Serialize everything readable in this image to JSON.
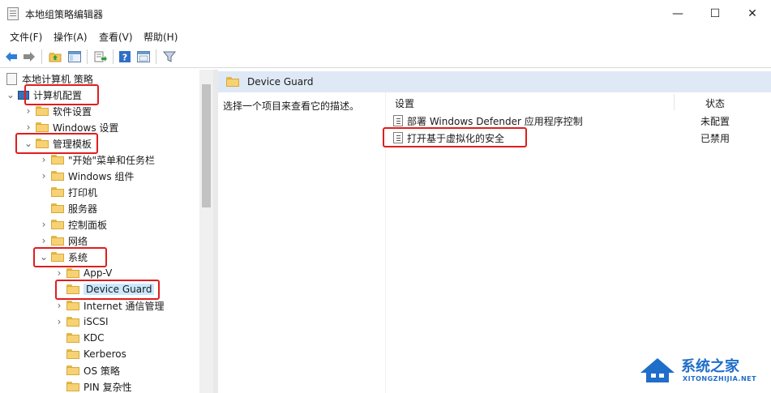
{
  "window": {
    "title": "本地组策略编辑器",
    "controls": {
      "minimize": "—",
      "maximize": "☐",
      "close": "✕"
    }
  },
  "menu": [
    "文件(F)",
    "操作(A)",
    "查看(V)",
    "帮助(H)"
  ],
  "toolbar": [
    "back-arrow-icon",
    "forward-arrow-icon",
    "up-folder-icon",
    "show-hide-tree-icon",
    "export-list-icon",
    "help-icon",
    "properties-icon",
    "filter-icon"
  ],
  "tree": [
    {
      "label": "本地计算机 策略",
      "depth": 0,
      "expander": "",
      "icon": "policy"
    },
    {
      "label": "计算机配置",
      "depth": 0,
      "expander": "v",
      "icon": "computer"
    },
    {
      "label": "软件设置",
      "depth": 1,
      "expander": ">",
      "icon": "folder"
    },
    {
      "label": "Windows 设置",
      "depth": 1,
      "expander": ">",
      "icon": "folder"
    },
    {
      "label": "管理模板",
      "depth": 1,
      "expander": "v",
      "icon": "folder"
    },
    {
      "label": "\"开始\"菜单和任务栏",
      "depth": 2,
      "expander": ">",
      "icon": "folder"
    },
    {
      "label": "Windows 组件",
      "depth": 2,
      "expander": ">",
      "icon": "folder"
    },
    {
      "label": "打印机",
      "depth": 2,
      "expander": "",
      "icon": "folder"
    },
    {
      "label": "服务器",
      "depth": 2,
      "expander": "",
      "icon": "folder"
    },
    {
      "label": "控制面板",
      "depth": 2,
      "expander": ">",
      "icon": "folder"
    },
    {
      "label": "网络",
      "depth": 2,
      "expander": ">",
      "icon": "folder"
    },
    {
      "label": "系统",
      "depth": 2,
      "expander": "v",
      "icon": "folder"
    },
    {
      "label": "App-V",
      "depth": 3,
      "expander": ">",
      "icon": "folder"
    },
    {
      "label": "Device Guard",
      "depth": 3,
      "expander": "",
      "icon": "folder",
      "selected": true
    },
    {
      "label": "Internet 通信管理",
      "depth": 3,
      "expander": ">",
      "icon": "folder"
    },
    {
      "label": "iSCSI",
      "depth": 3,
      "expander": ">",
      "icon": "folder"
    },
    {
      "label": "KDC",
      "depth": 3,
      "expander": "",
      "icon": "folder"
    },
    {
      "label": "Kerberos",
      "depth": 3,
      "expander": "",
      "icon": "folder"
    },
    {
      "label": "OS 策略",
      "depth": 3,
      "expander": "",
      "icon": "folder"
    },
    {
      "label": "PIN 复杂性",
      "depth": 3,
      "expander": "",
      "icon": "folder"
    }
  ],
  "right": {
    "header": "Device Guard",
    "description": "选择一个项目来查看它的描述。",
    "columns": {
      "setting": "设置",
      "state": "状态"
    },
    "rows": [
      {
        "name": "部署 Windows Defender 应用程序控制",
        "state": "未配置"
      },
      {
        "name": "打开基于虚拟化的安全",
        "state": "已禁用"
      }
    ]
  },
  "watermark": {
    "title": "系统之家",
    "subtitle": "XITONGZHIJIA.NET"
  },
  "colors": {
    "highlight": "#e01e1e",
    "selection": "#cce8ff",
    "header": "#dfe9f5",
    "watermark": "#1f6ec9"
  }
}
